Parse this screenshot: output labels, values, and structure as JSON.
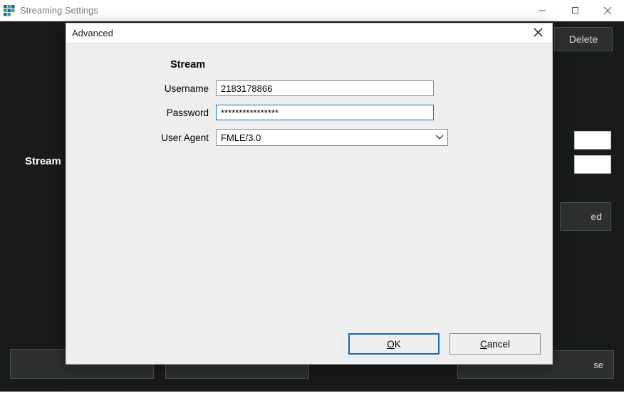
{
  "window": {
    "title": "Streaming Settings"
  },
  "background": {
    "delete_label": "Delete",
    "side_label": "Stream",
    "partial_btn_suffix1": "ed",
    "partial_btn_suffix2": "se"
  },
  "dialog": {
    "title": "Advanced",
    "section_header": "Stream",
    "labels": {
      "username": "Username",
      "password": "Password",
      "user_agent": "User Agent"
    },
    "values": {
      "username": "2183178866",
      "password": "****************",
      "user_agent": "FMLE/3.0"
    },
    "buttons": {
      "ok_pre": "",
      "ok_u": "O",
      "ok_post": "K",
      "cancel_pre": "",
      "cancel_u": "C",
      "cancel_post": "ancel"
    }
  }
}
